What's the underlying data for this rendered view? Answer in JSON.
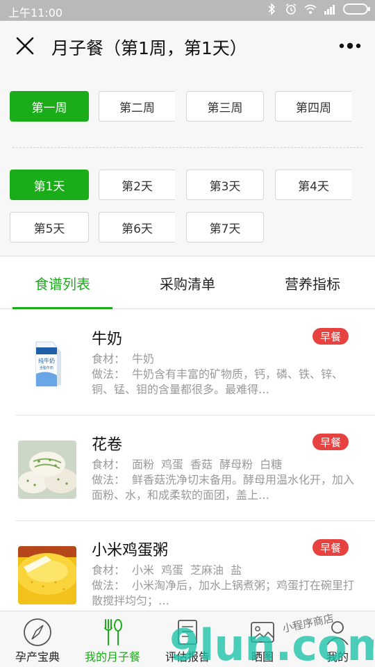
{
  "status_bar": {
    "time": "上午11:00"
  },
  "header": {
    "title": "月子餐（第1周，第1天）"
  },
  "weeks": [
    {
      "label": "第一周",
      "active": true
    },
    {
      "label": "第二周",
      "active": false
    },
    {
      "label": "第三周",
      "active": false
    },
    {
      "label": "第四周",
      "active": false
    }
  ],
  "days": [
    {
      "label": "第1天",
      "active": true
    },
    {
      "label": "第2天",
      "active": false
    },
    {
      "label": "第3天",
      "active": false
    },
    {
      "label": "第4天",
      "active": false
    },
    {
      "label": "第5天",
      "active": false
    },
    {
      "label": "第6天",
      "active": false
    },
    {
      "label": "第7天",
      "active": false
    }
  ],
  "tabs": [
    {
      "label": "食谱列表",
      "active": true
    },
    {
      "label": "采购清单",
      "active": false
    },
    {
      "label": "营养指标",
      "active": false
    }
  ],
  "labels": {
    "ingredients": "食材：",
    "method": "做法："
  },
  "recipes": [
    {
      "name": "牛奶",
      "meal": "早餐",
      "ingredients": [
        "牛奶"
      ],
      "method": "牛奶含有丰富的矿物质，钙，磷、铁、锌、铜、锰、钼的含量都很多。最难得…",
      "image": "milk-carton",
      "carton_text": {
        "brand": "纯牛奶",
        "sub": "全脂牛奶"
      }
    },
    {
      "name": "花卷",
      "meal": "早餐",
      "ingredients": [
        "面粉",
        "鸡蛋",
        "香菇",
        "酵母粉",
        "白糖"
      ],
      "method": "鲜香菇洗净切末备用。酵母用温水化开，加入面粉、水，和成柔软的面团，盖上…",
      "image": "steamed-buns"
    },
    {
      "name": "小米鸡蛋粥",
      "meal": "早餐",
      "ingredients": [
        "小米",
        "鸡蛋",
        "芝麻油",
        "盐"
      ],
      "method": "小米淘净后，加水上锅煮粥；鸡蛋打在碗里打散搅拌均匀；…",
      "image": "millet-porridge"
    }
  ],
  "bottom_nav": [
    {
      "label": "孕产宝典",
      "icon": "compass-icon",
      "active": false
    },
    {
      "label": "我的月子餐",
      "icon": "utensils-icon",
      "active": true
    },
    {
      "label": "评估报告",
      "icon": "report-icon",
      "active": false
    },
    {
      "label": "晒图",
      "icon": "image-icon",
      "active": false
    },
    {
      "label": "我的",
      "icon": "user-icon",
      "active": false
    }
  ],
  "watermark": {
    "text": "9lun.com",
    "handwriting": "小程序商店"
  },
  "colors": {
    "accent": "#1aad19",
    "badge": "#e64340",
    "status_bar": "#b9b9b9"
  }
}
